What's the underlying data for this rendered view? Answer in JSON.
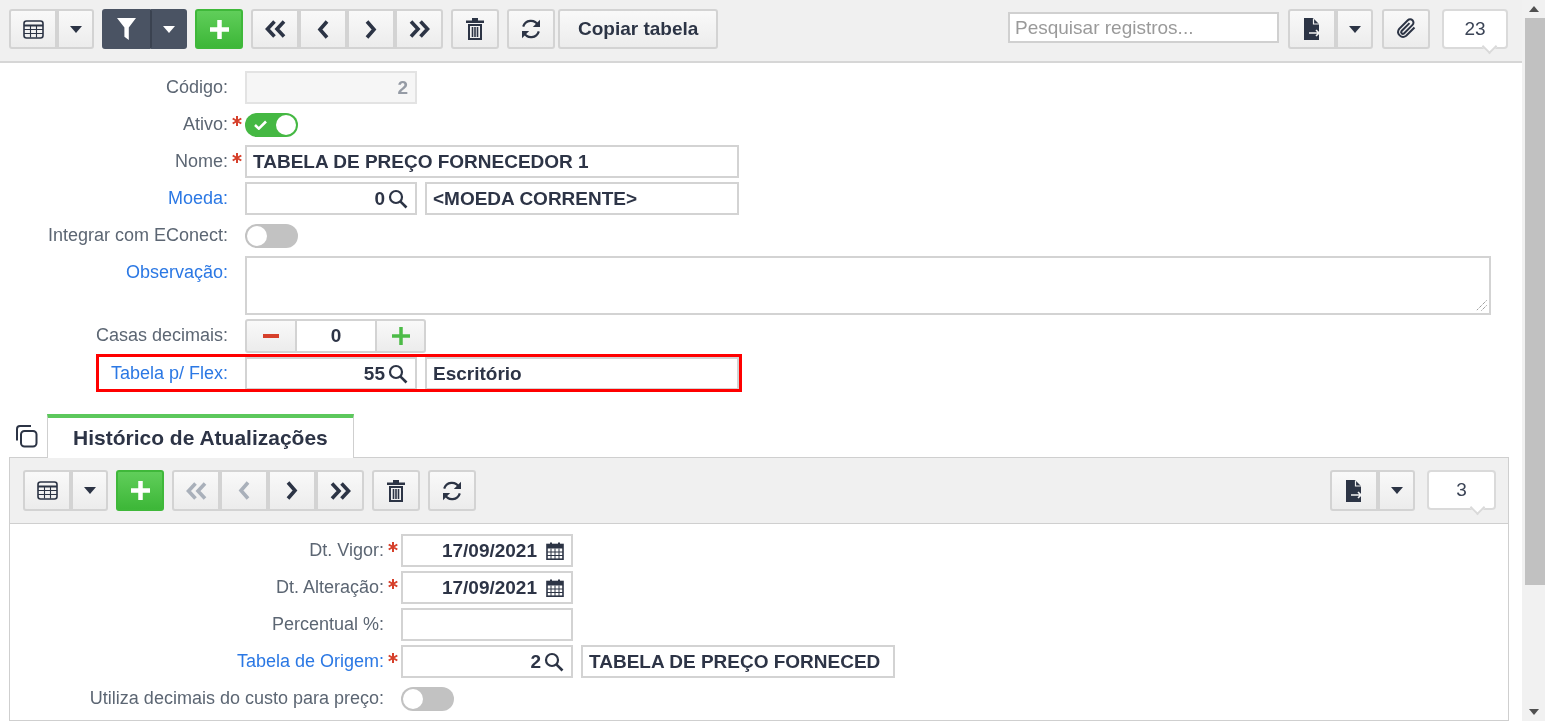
{
  "toolbar": {
    "groups": [
      {
        "active": false,
        "buttons": [
          {
            "kind": "grid",
            "disabled": false
          },
          {
            "kind": "caret",
            "disabled": false
          }
        ]
      },
      {
        "active": true,
        "buttons": [
          {
            "kind": "filter",
            "disabled": false
          },
          {
            "kind": "caret",
            "disabled": false
          }
        ]
      },
      {
        "active": false,
        "buttons": [
          {
            "kind": "add",
            "disabled": false
          }
        ]
      },
      {
        "active": false,
        "buttons": [
          {
            "kind": "first",
            "disabled": false
          },
          {
            "kind": "prev",
            "disabled": false
          },
          {
            "kind": "next",
            "disabled": false
          },
          {
            "kind": "last",
            "disabled": false
          }
        ]
      },
      {
        "active": false,
        "buttons": [
          {
            "kind": "delete",
            "disabled": false
          }
        ]
      },
      {
        "active": false,
        "buttons": [
          {
            "kind": "refresh",
            "disabled": false
          }
        ]
      },
      {
        "active": false,
        "buttons": [
          {
            "kind": "copy",
            "label": "Copiar tabela",
            "disabled": false
          }
        ]
      }
    ],
    "search": {
      "placeholder": "Pesquisar registros..."
    },
    "right_groups": [
      {
        "active": false,
        "buttons": [
          {
            "kind": "export",
            "disabled": false
          },
          {
            "kind": "caret",
            "disabled": false
          }
        ]
      },
      {
        "active": false,
        "buttons": [
          {
            "kind": "attach",
            "disabled": false
          }
        ]
      }
    ],
    "record_count": "23"
  },
  "form": {
    "fields": [
      {
        "kind": "code",
        "label": "Código:",
        "link": false,
        "required": false,
        "disabled": true,
        "value": "2",
        "highlighted": false
      },
      {
        "kind": "toggle",
        "label": "Ativo:",
        "link": false,
        "required": true,
        "on": true,
        "highlighted": false
      },
      {
        "kind": "text",
        "label": "Nome:",
        "link": false,
        "required": true,
        "value": "TABELA DE PREÇO FORNECEDOR 1",
        "highlighted": false
      },
      {
        "kind": "lookup",
        "label": "Moeda:",
        "link": true,
        "required": false,
        "code": "0",
        "description": "<MOEDA CORRENTE>",
        "highlighted": false
      },
      {
        "kind": "toggle",
        "label": "Integrar com EConect:",
        "link": false,
        "required": false,
        "on": false,
        "highlighted": false
      },
      {
        "kind": "textarea",
        "label": "Observação:",
        "link": true,
        "required": false,
        "highlighted": false
      },
      {
        "kind": "stepper",
        "label": "Casas decimais:",
        "link": false,
        "required": false,
        "value": "0",
        "highlighted": false
      },
      {
        "kind": "lookup",
        "label": "Tabela p/ Flex:",
        "link": true,
        "required": false,
        "code": "55",
        "description": "Escritório",
        "highlighted": true
      }
    ]
  },
  "tabs": [
    {
      "label": "Histórico de Atualizações",
      "selected": true
    }
  ],
  "detail": {
    "toolbar": {
      "groups": [
        {
          "active": false,
          "buttons": [
            {
              "kind": "grid",
              "disabled": false
            },
            {
              "kind": "caret",
              "disabled": false
            }
          ]
        },
        {
          "active": false,
          "buttons": [
            {
              "kind": "add",
              "disabled": false
            }
          ]
        },
        {
          "active": false,
          "buttons": [
            {
              "kind": "first",
              "disabled": true
            },
            {
              "kind": "prev",
              "disabled": true
            },
            {
              "kind": "next",
              "disabled": false
            },
            {
              "kind": "last",
              "disabled": false
            }
          ]
        },
        {
          "active": false,
          "buttons": [
            {
              "kind": "delete",
              "disabled": false
            }
          ]
        },
        {
          "active": false,
          "buttons": [
            {
              "kind": "refresh",
              "disabled": false
            }
          ]
        }
      ],
      "right_groups": [
        {
          "active": false,
          "buttons": [
            {
              "kind": "export",
              "disabled": false
            },
            {
              "kind": "caret",
              "disabled": false
            }
          ]
        }
      ],
      "record_count": "3"
    },
    "fields": [
      {
        "kind": "date",
        "label": "Dt. Vigor:",
        "link": false,
        "required": true,
        "value": "17/09/2021"
      },
      {
        "kind": "date",
        "label": "Dt. Alteração:",
        "link": false,
        "required": true,
        "value": "17/09/2021"
      },
      {
        "kind": "code",
        "label": "Percentual %:",
        "link": false,
        "required": false,
        "disabled": false
      },
      {
        "kind": "lookup",
        "label": "Tabela de Origem:",
        "link": true,
        "required": true,
        "code": "2",
        "description": "TABELA DE PREÇO FORNECED"
      },
      {
        "kind": "toggle",
        "label": "Utiliza decimais do custo para preço:",
        "link": false,
        "required": false,
        "on": false
      }
    ]
  }
}
